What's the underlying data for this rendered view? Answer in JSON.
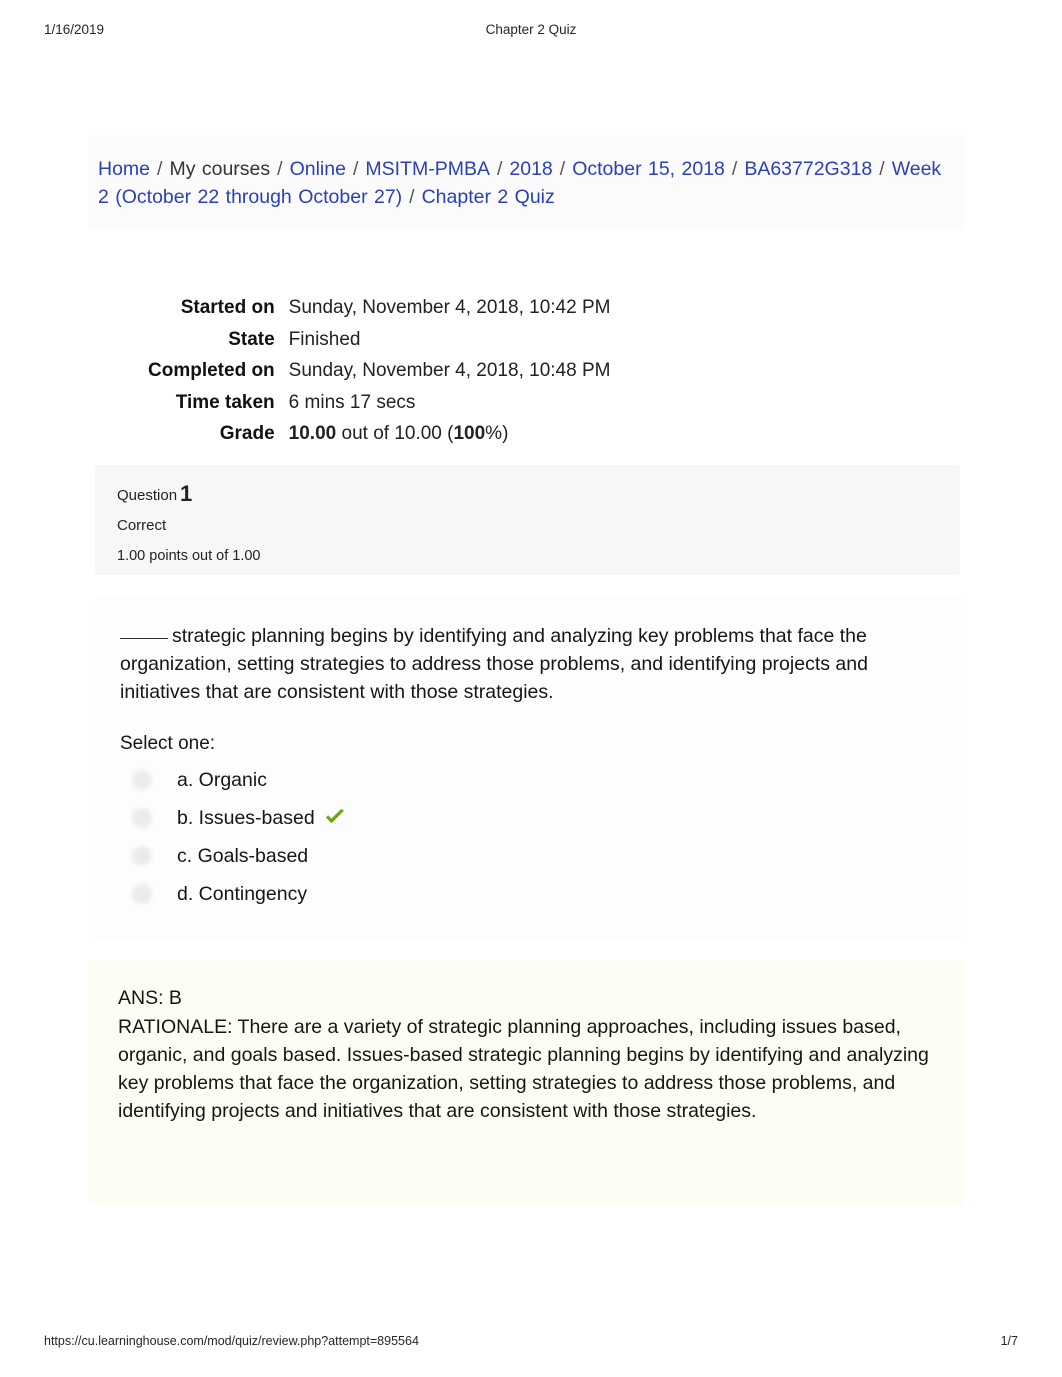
{
  "print": {
    "date": "1/16/2019",
    "title": "Chapter 2 Quiz",
    "url": "https://cu.learninghouse.com/mod/quiz/review.php?attempt=895564",
    "page_number": "1/7"
  },
  "colors": {
    "link": "#2a3fb8",
    "correct_tick": "#6aa713",
    "feedback_bg": "#fdfdf4",
    "info_panel_bg": "#f7f7f7"
  },
  "breadcrumb": {
    "separator": "/",
    "items": [
      {
        "label": "Home",
        "is_link": true
      },
      {
        "label": "My courses",
        "is_link": false
      },
      {
        "label": "Online",
        "is_link": true
      },
      {
        "label": "MSITM-PMBA",
        "is_link": true
      },
      {
        "label": "2018",
        "is_link": true
      },
      {
        "label": "October 15, 2018",
        "is_link": true
      },
      {
        "label": "BA63772G318",
        "is_link": true
      },
      {
        "label": "Week 2 (October 22 through October 27)",
        "is_link": true
      },
      {
        "label": "Chapter 2 Quiz",
        "is_link": true
      }
    ]
  },
  "summary": {
    "rows": [
      {
        "label": "Started on",
        "value": "Sunday, November 4, 2018, 10:42 PM"
      },
      {
        "label": "State",
        "value": "Finished"
      },
      {
        "label": "Completed on",
        "value": "Sunday, November 4, 2018, 10:48 PM"
      },
      {
        "label": "Time taken",
        "value": "6 mins 17 secs"
      }
    ],
    "grade": {
      "label": "Grade",
      "earned": "10.00",
      "middle": " out of 10.00 (",
      "percent": "100",
      "suffix": "%)"
    }
  },
  "question": {
    "number_label": "Question",
    "number": "1",
    "state": "Correct",
    "marks": "1.00 points out of 1.00",
    "blank": "_____",
    "text": "strategic planning begins by identifying and analyzing key problems that face the organization, setting strategies to address those problems, and identifying projects and initiatives that are consistent with those strategies.",
    "select_prompt": "Select one:",
    "options": [
      {
        "label": "a. Organic",
        "correct": false
      },
      {
        "label": "b. Issues-based",
        "correct": true
      },
      {
        "label": "c. Goals-based",
        "correct": false
      },
      {
        "label": "d. Contingency",
        "correct": false
      }
    ]
  },
  "feedback": {
    "answer_line": "ANS: B",
    "rationale": "RATIONALE: There are a variety of strategic planning approaches, including issues based, organic, and goals based. Issues-based strategic planning begins by identifying and analyzing key problems that face the organization, setting strategies to address those problems, and identifying projects and initiatives that are consistent with those strategies."
  }
}
